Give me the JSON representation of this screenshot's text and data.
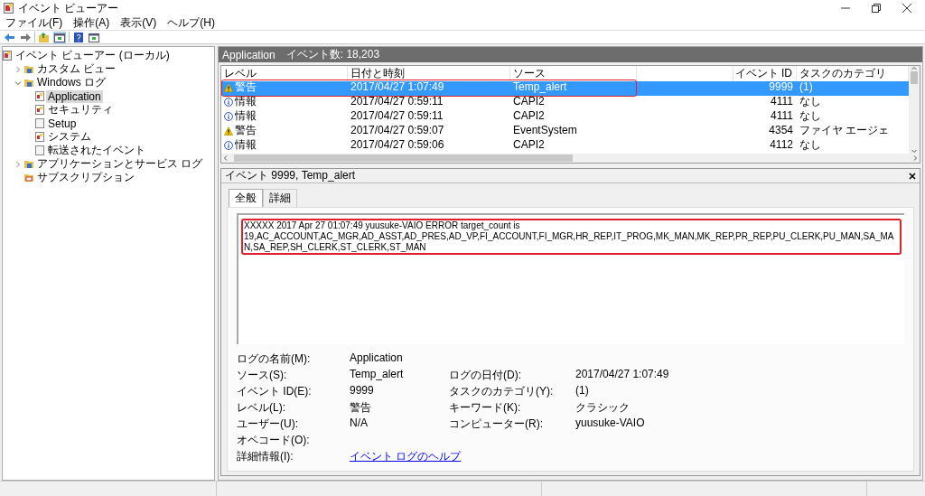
{
  "window": {
    "title": "イベント ビューアー"
  },
  "menu": [
    "ファイル(F)",
    "操作(A)",
    "表示(V)",
    "ヘルプ(H)"
  ],
  "toolbar": [
    {
      "kind": "back",
      "selected": false
    },
    {
      "kind": "forward",
      "selected": false
    },
    {
      "kind": "up",
      "selected": false
    },
    {
      "kind": "panel",
      "selected": true
    },
    {
      "kind": "help",
      "selected": false
    },
    {
      "kind": "panel",
      "selected": false
    }
  ],
  "tree": [
    {
      "label": "イベント ビューアー (ローカル)",
      "kind": "root",
      "selected": false,
      "children": [
        {
          "label": "カスタム ビュー",
          "kind": "folder",
          "selected": false,
          "expanded": false
        },
        {
          "label": "Windows ログ",
          "kind": "folder",
          "selected": false,
          "expanded": true,
          "children": [
            {
              "label": "Application",
              "kind": "log",
              "selected": true
            },
            {
              "label": "セキュリティ",
              "kind": "log",
              "selected": false
            },
            {
              "label": "Setup",
              "kind": "plain",
              "selected": false
            },
            {
              "label": "システム",
              "kind": "log",
              "selected": false
            },
            {
              "label": "転送されたイベント",
              "kind": "plain",
              "selected": false
            }
          ]
        },
        {
          "label": "アプリケーションとサービス ログ",
          "kind": "folder",
          "selected": false,
          "expanded": false
        },
        {
          "label": "サブスクリプション",
          "kind": "subs",
          "selected": false
        }
      ]
    }
  ],
  "list_header": {
    "title": "Application",
    "count": "イベント数: 18,203"
  },
  "table": {
    "columns": [
      "レベル",
      "日付と時刻",
      "ソース",
      "イベント ID",
      "タスクのカテゴリ"
    ],
    "rows": [
      {
        "kind": "warning",
        "level": "警告",
        "datetime": "2017/04/27 1:07:49",
        "source": "Temp_alert",
        "event_id": "9999",
        "category": "(1)",
        "selected": true,
        "highlighted": true
      },
      {
        "kind": "info",
        "level": "情報",
        "datetime": "2017/04/27 0:59:11",
        "source": "CAPI2",
        "event_id": "4111",
        "category": "なし",
        "selected": false,
        "highlighted": false
      },
      {
        "kind": "info",
        "level": "情報",
        "datetime": "2017/04/27 0:59:11",
        "source": "CAPI2",
        "event_id": "4111",
        "category": "なし",
        "selected": false,
        "highlighted": false
      },
      {
        "kind": "warning",
        "level": "警告",
        "datetime": "2017/04/27 0:59:07",
        "source": "EventSystem",
        "event_id": "4354",
        "category": "ファイヤ エージェ",
        "selected": false,
        "highlighted": false
      },
      {
        "kind": "info",
        "level": "情報",
        "datetime": "2017/04/27 0:59:06",
        "source": "CAPI2",
        "event_id": "4112",
        "category": "なし",
        "selected": false,
        "highlighted": false
      }
    ]
  },
  "detail": {
    "title": "イベント 9999, Temp_alert",
    "tabs": [
      {
        "label": "全般",
        "selected": true
      },
      {
        "label": "詳細",
        "selected": false
      }
    ],
    "message": {
      "lines": [
        "XXXXX 2017 Apr 27 01:07:49 yuusuke-VAIO ERROR target_count is",
        "19,AC_ACCOUNT,AC_MGR,AD_ASST,AD_PRES,AD_VP,FI_ACCOUNT,FI_MGR,HR_REP,IT_PROG,MK_MAN,MK_REP,PR_REP,PU_CLERK,PU_MAN,SA_MAN,SA_REP,SH_CLERK,ST_CLERK,ST_MAN"
      ],
      "highlighted": true
    },
    "fields": [
      [
        {
          "label": "ログの名前(M):",
          "value": "Application"
        }
      ],
      [
        {
          "label": "ソース(S):",
          "value": "Temp_alert"
        },
        {
          "label": "ログの日付(D):",
          "value": "2017/04/27 1:07:49"
        }
      ],
      [
        {
          "label": "イベント ID(E):",
          "value": "9999"
        },
        {
          "label": "タスクのカテゴリ(Y):",
          "value": "(1)"
        }
      ],
      [
        {
          "label": "レベル(L):",
          "value": "警告"
        },
        {
          "label": "キーワード(K):",
          "value": "クラシック"
        }
      ],
      [
        {
          "label": "ユーザー(U):",
          "value": "N/A"
        },
        {
          "label": "コンピューター(R):",
          "value": "yuusuke-VAIO"
        }
      ],
      [
        {
          "label": "オペコード(O):"
        }
      ],
      [
        {
          "label": "詳細情報(I):",
          "value": "イベント ログのヘルプ",
          "kind": "link"
        }
      ]
    ]
  }
}
